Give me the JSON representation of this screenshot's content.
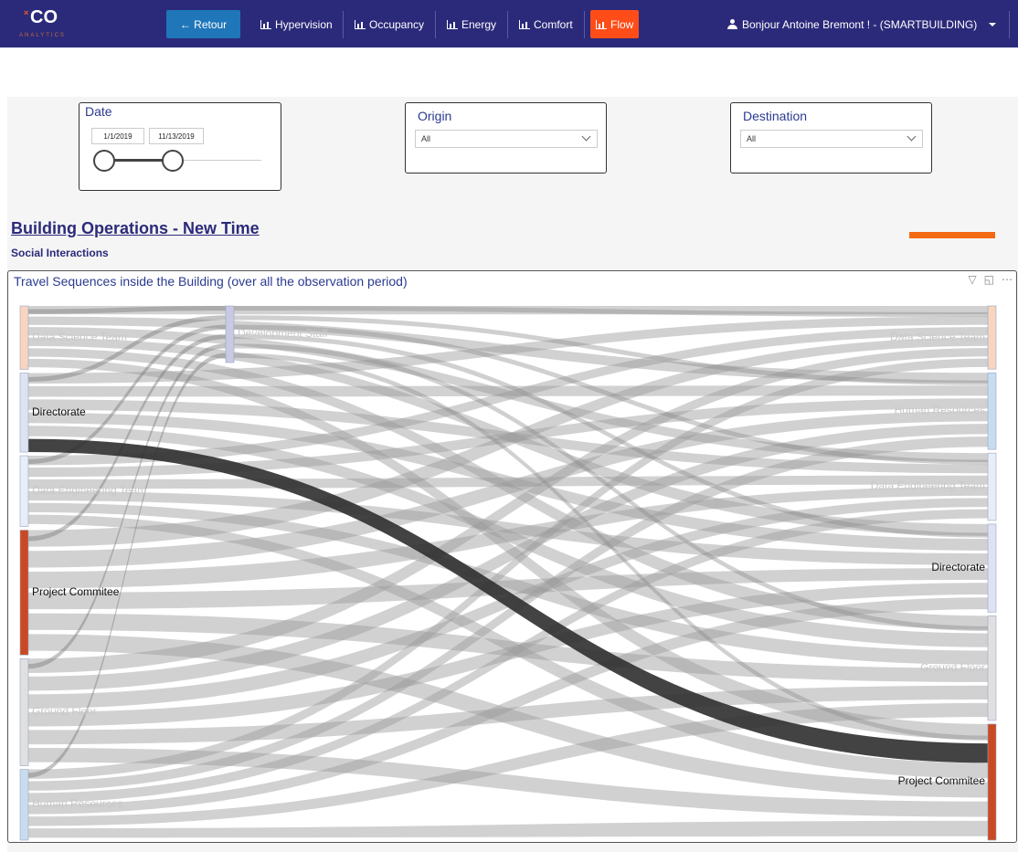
{
  "header": {
    "logo_mark": "×",
    "logo_text": "CO",
    "logo_sub": "ANALYTICS",
    "back_label": "← Retour",
    "nav": [
      "Hypervision",
      "Occupancy",
      "Energy",
      "Comfort",
      "Flow"
    ],
    "user_label": "Bonjour Antoine Bremont ! - (SMARTBUILDING)"
  },
  "filters": {
    "date": {
      "title": "Date",
      "start": "1/1/2019",
      "end": "11/13/2019"
    },
    "origin": {
      "title": "Origin",
      "value": "All"
    },
    "destination": {
      "title": "Destination",
      "value": "All"
    }
  },
  "page": {
    "title": "Building Operations - New Time",
    "subtitle": "Social Interactions",
    "visual_title": "Travel Sequences inside the Building (over all the observation period)"
  },
  "colors": {
    "nav_bg": "#2b2a7a",
    "back_button": "#1f76b8",
    "active_tab": "#ff4d1a",
    "accent": "#f26a13"
  },
  "icons": [
    "arrow-left-icon",
    "chart-icon",
    "user-icon",
    "caret-down-icon",
    "filter-icon",
    "focus-mode-icon",
    "more-options-icon",
    "chevron-down-icon"
  ],
  "chart_data": {
    "type": "sankey",
    "nodes_left": [
      {
        "name": "Data Science Team",
        "color": "#f7d5bf",
        "share": 0.061
      },
      {
        "name": "Directorate",
        "color": "#dde3f1",
        "share": 0.076
      },
      {
        "name": "Data Engineering Team",
        "color": "#e7eef7",
        "share": 0.068
      },
      {
        "name": "Project Commitee",
        "color": "#c94a22",
        "share": 0.12
      },
      {
        "name": "Ground Floor",
        "color": "#e0e0e0",
        "share": 0.103
      },
      {
        "name": "Human Resources",
        "color": "#c7dcee",
        "share": 0.068
      }
    ],
    "nodes_middle": [
      {
        "name": "Development Staff",
        "color": "#c9c9e3",
        "share": 0.057
      }
    ],
    "nodes_right": [
      {
        "name": "Data Science Team",
        "color": "#f7d5bf",
        "share": 0.061
      },
      {
        "name": "Human Resources",
        "color": "#c7dcee",
        "share": 0.074
      },
      {
        "name": "Data Engineering Team",
        "color": "#e7eef7",
        "share": 0.065
      },
      {
        "name": "Directorate",
        "color": "#dde3f1",
        "share": 0.085
      },
      {
        "name": "Ground Floor",
        "color": "#e0e0e0",
        "share": 0.101
      },
      {
        "name": "Project Commitee",
        "color": "#c94a22",
        "share": 0.112
      }
    ],
    "highlighted_flow": {
      "from": "Directorate",
      "to": "Project Commitee"
    }
  }
}
